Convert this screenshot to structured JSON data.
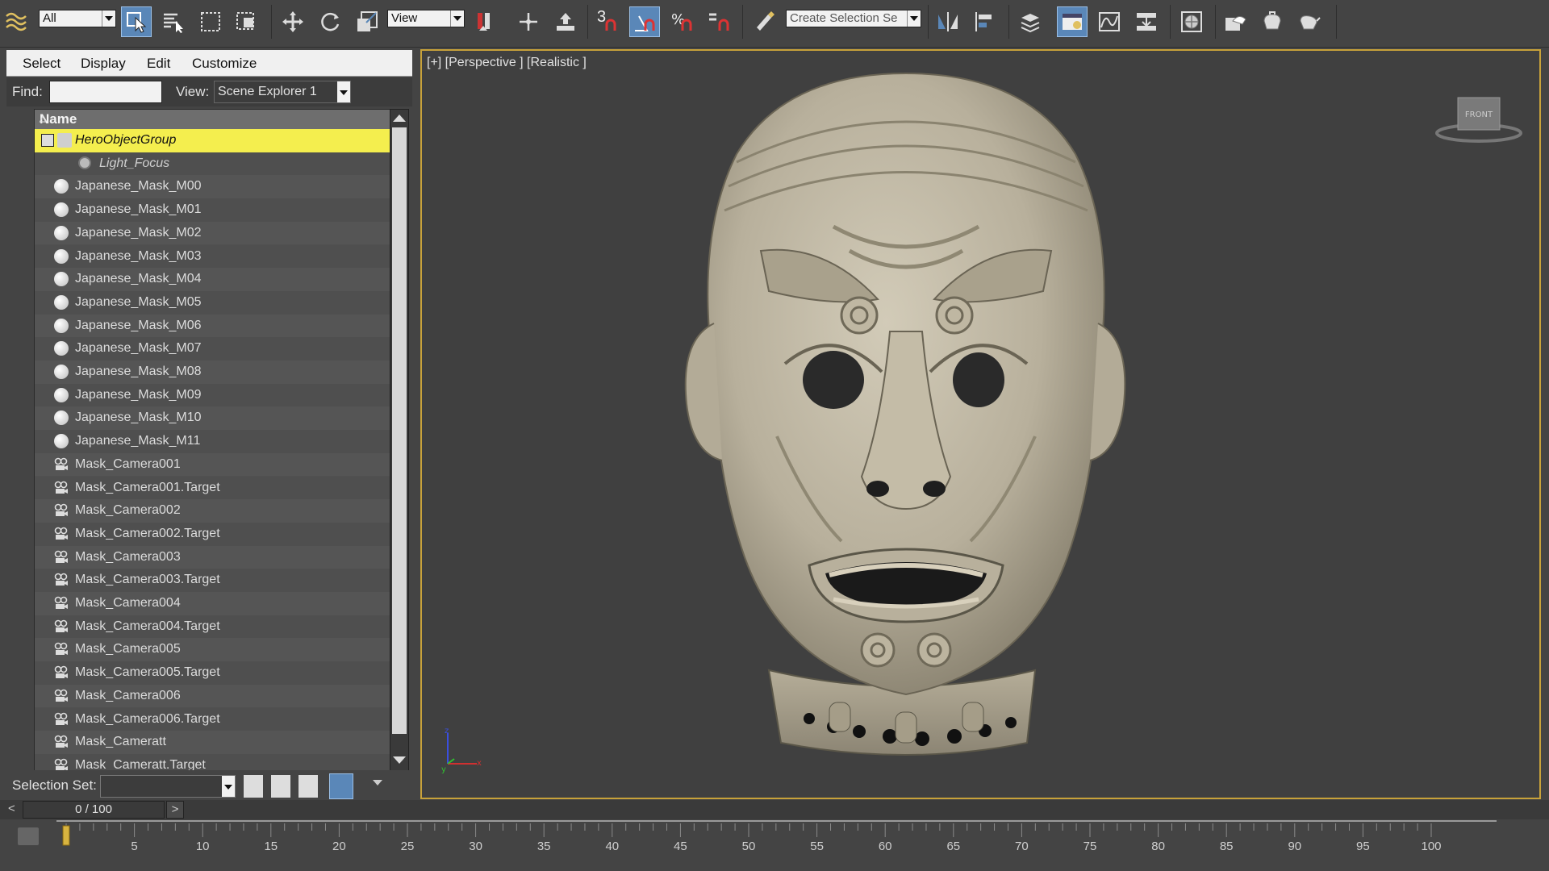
{
  "toolbar": {
    "selection_filter": "All",
    "reference_coord": "View",
    "snap_label": "3",
    "selection_set_placeholder": "Create Selection Se",
    "icons": [
      "undo-logo-icon",
      "select-object-icon",
      "select-by-name-icon",
      "rect-region-icon",
      "window-crossing-icon",
      "move-icon",
      "rotate-icon",
      "scale-icon",
      "select-link-icon",
      "pivot-icon",
      "select-manipulate-icon",
      "snap-toggle-icon",
      "angle-snap-icon",
      "percent-snap-icon",
      "spinner-snap-icon",
      "edit-named-sets-icon",
      "mirror-icon",
      "align-icon",
      "layer-manager-icon",
      "scene-explorer-icon",
      "curve-editor-icon",
      "schematic-view-icon",
      "material-editor-icon",
      "render-setup-icon",
      "render-frame-icon",
      "render-icon"
    ]
  },
  "explorer": {
    "menu": [
      "Select",
      "Display",
      "Edit",
      "Customize"
    ],
    "find_label": "Find:",
    "find_value": "",
    "view_label": "View:",
    "view_value": "Scene Explorer 1",
    "header_name": "Name",
    "rows": [
      {
        "label": "HeroObjectGroup",
        "type": "group",
        "selected": true
      },
      {
        "label": "Light_Focus",
        "type": "light-child"
      },
      {
        "label": "Japanese_Mask_M00",
        "type": "geometry"
      },
      {
        "label": "Japanese_Mask_M01",
        "type": "geometry"
      },
      {
        "label": "Japanese_Mask_M02",
        "type": "geometry"
      },
      {
        "label": "Japanese_Mask_M03",
        "type": "geometry"
      },
      {
        "label": "Japanese_Mask_M04",
        "type": "geometry"
      },
      {
        "label": "Japanese_Mask_M05",
        "type": "geometry"
      },
      {
        "label": "Japanese_Mask_M06",
        "type": "geometry"
      },
      {
        "label": "Japanese_Mask_M07",
        "type": "geometry"
      },
      {
        "label": "Japanese_Mask_M08",
        "type": "geometry"
      },
      {
        "label": "Japanese_Mask_M09",
        "type": "geometry"
      },
      {
        "label": "Japanese_Mask_M10",
        "type": "geometry"
      },
      {
        "label": "Japanese_Mask_M11",
        "type": "geometry"
      },
      {
        "label": "Mask_Camera001",
        "type": "camera"
      },
      {
        "label": "Mask_Camera001.Target",
        "type": "camera"
      },
      {
        "label": "Mask_Camera002",
        "type": "camera"
      },
      {
        "label": "Mask_Camera002.Target",
        "type": "camera"
      },
      {
        "label": "Mask_Camera003",
        "type": "camera"
      },
      {
        "label": "Mask_Camera003.Target",
        "type": "camera"
      },
      {
        "label": "Mask_Camera004",
        "type": "camera"
      },
      {
        "label": "Mask_Camera004.Target",
        "type": "camera"
      },
      {
        "label": "Mask_Camera005",
        "type": "camera"
      },
      {
        "label": "Mask_Camera005.Target",
        "type": "camera"
      },
      {
        "label": "Mask_Camera006",
        "type": "camera"
      },
      {
        "label": "Mask_Camera006.Target",
        "type": "camera"
      },
      {
        "label": "Mask_Cameratt",
        "type": "camera"
      },
      {
        "label": "Mask_Cameratt.Target",
        "type": "camera"
      }
    ],
    "selection_set_label": "Selection Set:",
    "selection_set_value": ""
  },
  "viewport": {
    "label": "[+] [Perspective ] [Realistic ]",
    "viewcube_face": "FRONT",
    "axis_x": "x",
    "axis_y": "y",
    "axis_z": "z",
    "border_color": "#c8a23a"
  },
  "timeline": {
    "frame_display": "0 / 100",
    "prev": "<",
    "next": ">",
    "ticks": [
      "5",
      "10",
      "15",
      "20",
      "25",
      "30",
      "35",
      "40",
      "45",
      "50",
      "55",
      "60",
      "65",
      "70",
      "75",
      "80",
      "85",
      "90",
      "95",
      "100"
    ]
  },
  "colors": {
    "selection_highlight": "#f4ee4e",
    "active_button": "#5a87b8",
    "mask_surface": "#bdb5a2"
  }
}
